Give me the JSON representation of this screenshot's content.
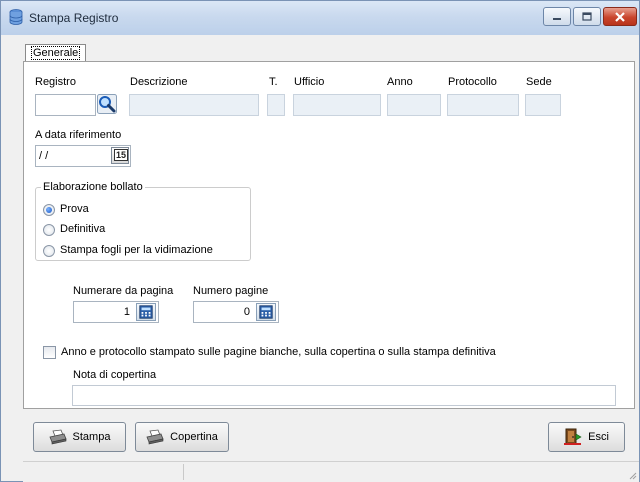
{
  "window": {
    "title": "Stampa Registro"
  },
  "tabs": [
    {
      "label": "Generale",
      "active": true
    }
  ],
  "header_fields": {
    "registro_label": "Registro",
    "descrizione_label": "Descrizione",
    "t_label": "T.",
    "ufficio_label": "Ufficio",
    "anno_label": "Anno",
    "protocollo_label": "Protocollo",
    "sede_label": "Sede",
    "registro_value": "",
    "descrizione_value": "",
    "t_value": "",
    "ufficio_value": "",
    "anno_value": "",
    "protocollo_value": "",
    "sede_value": ""
  },
  "data_riferimento": {
    "label": "A data riferimento",
    "value": " / /",
    "calendar_text": "15"
  },
  "elaborazione": {
    "title": "Elaborazione bollato",
    "options": [
      {
        "label": "Prova",
        "checked": true
      },
      {
        "label": "Definitiva",
        "checked": false
      },
      {
        "label": "Stampa fogli per la vidimazione",
        "checked": false
      }
    ]
  },
  "numerazione": {
    "numerare_label": "Numerare da pagina",
    "numerare_value": "1",
    "numero_pagine_label": "Numero pagine",
    "numero_pagine_value": "0"
  },
  "anno_protocollo": {
    "label": "Anno e protocollo stampato sulle pagine bianche, sulla copertina o sulla stampa definitiva",
    "checked": false
  },
  "nota_copertina": {
    "label": "Nota di copertina",
    "value": ""
  },
  "buttons": {
    "stampa": "Stampa",
    "copertina": "Copertina",
    "esci": "Esci"
  },
  "colors": {
    "titlebar": "#c9d9ee",
    "close_button": "#c9452d",
    "field_bg": "#eaf0f6"
  }
}
